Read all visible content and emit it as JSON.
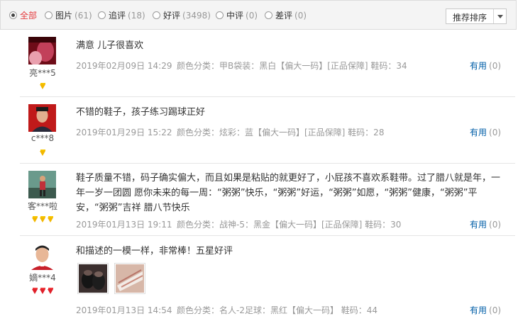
{
  "filters": [
    {
      "label": "全部",
      "count": "",
      "active": true
    },
    {
      "label": "图片",
      "count": "(61)"
    },
    {
      "label": "追评",
      "count": "(18)"
    },
    {
      "label": "好评",
      "count": "(3498)"
    },
    {
      "label": "中评",
      "count": "(0)"
    },
    {
      "label": "差评",
      "count": "(0)"
    }
  ],
  "sort": {
    "label": "推荐排序"
  },
  "reviews": [
    {
      "user": "亮***5",
      "comment": "满意 儿子很喜欢",
      "date": "2019年02月09日 14:29",
      "spec": "颜色分类：甲B袋装：黑白【偏大一码】[正品保障]  鞋码：34",
      "useful_label": "有用",
      "useful_count": "(0)",
      "medal_color": "gold"
    },
    {
      "user": "c***8",
      "comment": "不错的鞋子，孩子练习踢球正好",
      "date": "2019年01月29日 15:22",
      "spec": "颜色分类：炫彩：蓝【偏大一码】[正品保障]  鞋码：28",
      "useful_label": "有用",
      "useful_count": "(0)",
      "medal_color": "gold"
    },
    {
      "user": "客***啦",
      "comment": "鞋子质量不错，码子确实偏大，而且如果是粘贴的就更好了，小屁孩不喜欢系鞋带。过了腊八就是年，一年一岁一团圆 愿你未来的每一周：“粥粥”快乐，“粥粥”好运，“粥粥”如愿，“粥粥”健康，“粥粥”平安，“粥粥”吉祥 腊八节快乐",
      "date": "2019年01月13日 19:11",
      "spec": "颜色分类：战神-5：黑金【偏大一码】[正品保障]  鞋码：30",
      "useful_label": "有用",
      "useful_count": "(0)",
      "medal_color": "gold"
    },
    {
      "user": "嫡***4",
      "comment": "和描述的一模一样，非常棒！五星好评",
      "date": "2019年01月13日 14:54",
      "spec": "颜色分类：名人-2足球：黑红【偏大一码】  鞋码：44",
      "useful_label": "有用",
      "useful_count": "(0)",
      "medal_color": "red"
    }
  ]
}
